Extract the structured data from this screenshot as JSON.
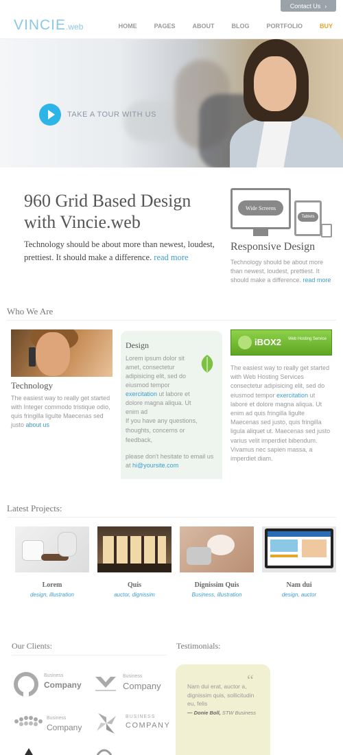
{
  "top": {
    "contact_label": "Contact Us",
    "contact_arrow": "›"
  },
  "header": {
    "logo_main": "VINCIE",
    "logo_suffix": ".web",
    "nav": [
      "HOME",
      "PAGES",
      "ABOUT",
      "BLOG",
      "PORTFOLIO",
      "BUY"
    ]
  },
  "hero": {
    "tour_label": "TAKE A TOUR WITH US"
  },
  "intro": {
    "title": "960 Grid Based Design with Vincie.web",
    "text": "Technology should be about more than newest, loudest, prettiest. It should make a difference.",
    "read_more": "read more"
  },
  "responsive": {
    "screen_label": "Wide Screens",
    "tablet_label": "Tablets",
    "title": "Responsive Design",
    "text": "Technology should be about more than newest, loudest, prettiest. It should make a difference.",
    "read_more": "read more"
  },
  "who": {
    "title": "Who We Are",
    "tech_title": "Technology",
    "tech_text": "The easiest way to really get started with Integer commodo tristique odio, quis fringilla ligulte Maecenas sed justo",
    "tech_link": "about us",
    "design_title": "Design",
    "design_text_1": "Lorem ipsum dolor sit amet, consectetur adipisicing elit, sed do eiusmod tempor",
    "design_link": "exercitation",
    "design_text_2": "ut labore et dolore magna aliqua. Ut enim ad",
    "design_note": "If you have any questions, thoughts, concerns or feedback,",
    "design_email_text": "please don't hesitate to email us at",
    "design_email": "hi@yoursite.com",
    "ibox_label": "iBOX2",
    "ibox_sub": "Web Hosting Service",
    "ibox_text_1": "The easiest way to really get started with Web Hosting Services consectetur adipisicing elit, sed do eiusmod tempor",
    "ibox_link": "exercitation",
    "ibox_text_2": "ut labore et dolore magna aliqua. Ut enim ad quis fringilla ligulte Maecenas sed justo, quis fringilla ligula aliquet ut. Maecenas sed justo varius velit imperdiet bibendum. Vivamus nec sapien massa, a imperdiet diam."
  },
  "projects": {
    "title": "Latest Projects:",
    "items": [
      {
        "title": "Lorem",
        "tags": "design, illustration"
      },
      {
        "title": "Quis",
        "tags": "auctor, dignissim"
      },
      {
        "title": "Dignissim Quis",
        "tags": "Business, illustration"
      },
      {
        "title": "Nam dui",
        "tags": "design, auctor"
      }
    ]
  },
  "clients": {
    "title": "Our Clients:",
    "logos": [
      {
        "top": "Business",
        "bottom": "Company"
      },
      {
        "top": "Business",
        "bottom": "Company"
      },
      {
        "top": "Business",
        "bottom": "Company"
      },
      {
        "top": "BUSINESS",
        "bottom": "COMPANY"
      }
    ]
  },
  "testimonials": {
    "title": "Testimonials:",
    "quote_mark": "“",
    "text": "Nam dui erat, auctor a, dignissim quis, sollicitudin eu, felis",
    "author_name": "— Donie Boll,",
    "author_company": "STW Business"
  },
  "colors": {
    "accent": "#3a9fd0",
    "play": "#2eb5e7",
    "buy": "#e8a32b",
    "ibox": "#6cb92a"
  }
}
